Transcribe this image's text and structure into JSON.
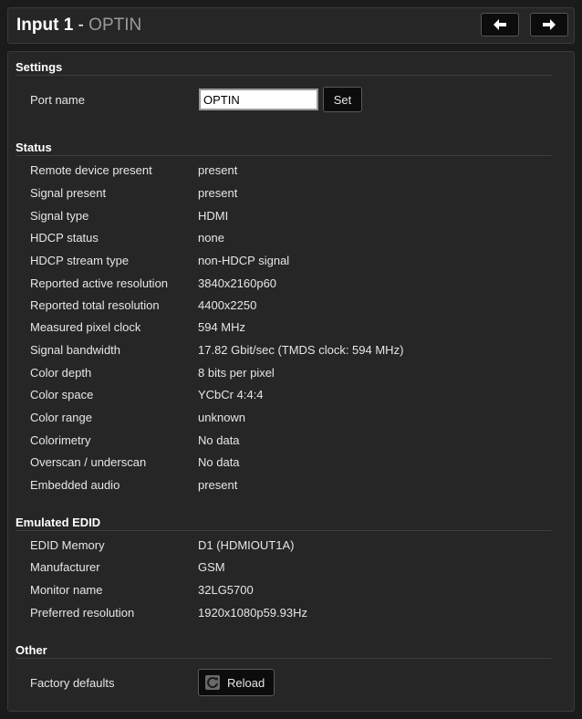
{
  "header": {
    "title": "Input 1",
    "separator": " - ",
    "port_name": "OPTIN",
    "prev_icon": "arrow-left-icon",
    "next_icon": "arrow-right-icon"
  },
  "settings": {
    "section_title": "Settings",
    "port_name_label": "Port name",
    "port_name_value": "OPTIN",
    "set_label": "Set"
  },
  "status": {
    "section_title": "Status",
    "rows": [
      {
        "label": "Remote device present",
        "value": "present"
      },
      {
        "label": "Signal present",
        "value": "present"
      },
      {
        "label": "Signal type",
        "value": "HDMI"
      },
      {
        "label": "HDCP status",
        "value": "none"
      },
      {
        "label": "HDCP stream type",
        "value": "non-HDCP signal"
      },
      {
        "label": "Reported active resolution",
        "value": "3840x2160p60"
      },
      {
        "label": "Reported total resolution",
        "value": "4400x2250"
      },
      {
        "label": "Measured pixel clock",
        "value": "594 MHz"
      },
      {
        "label": "Signal bandwidth",
        "value": "17.82 Gbit/sec (TMDS clock: 594 MHz)"
      },
      {
        "label": "Color depth",
        "value": "8 bits per pixel"
      },
      {
        "label": "Color space",
        "value": "YCbCr 4:4:4"
      },
      {
        "label": "Color range",
        "value": "unknown"
      },
      {
        "label": "Colorimetry",
        "value": "No data"
      },
      {
        "label": "Overscan / underscan",
        "value": "No data"
      },
      {
        "label": "Embedded audio",
        "value": "present"
      }
    ]
  },
  "edid": {
    "section_title": "Emulated EDID",
    "rows": [
      {
        "label": "EDID Memory",
        "value": "D1 (HDMIOUT1A)"
      },
      {
        "label": "Manufacturer",
        "value": "GSM"
      },
      {
        "label": "Monitor name",
        "value": "32LG5700"
      },
      {
        "label": "Preferred resolution",
        "value": "1920x1080p59.93Hz"
      }
    ]
  },
  "other": {
    "section_title": "Other",
    "factory_defaults_label": "Factory defaults",
    "reload_label": "Reload",
    "reload_icon": "reload-icon"
  }
}
